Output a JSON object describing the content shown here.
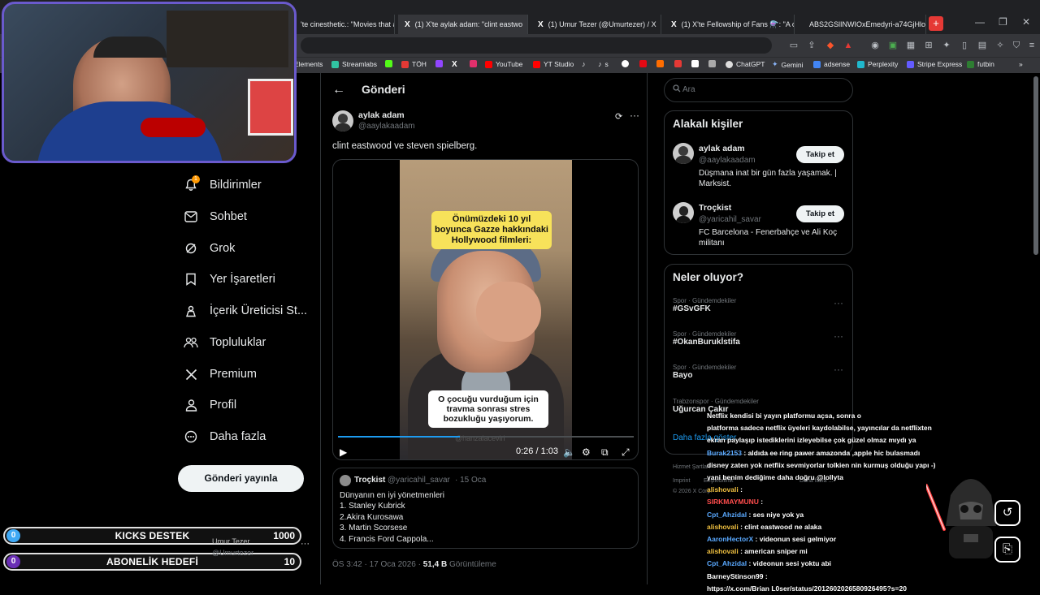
{
  "browser": {
    "tabs": [
      {
        "label": "'te cinesthetic.: \"Movies that are",
        "icon": "x-logo"
      },
      {
        "label": "(1) X'te aylak adam: \"clint eastwo",
        "icon": "x-logo"
      },
      {
        "label": "(1) Umur Tezer (@Umurtezer) / X",
        "icon": "x-logo"
      },
      {
        "label": "(1) X'te Fellowship of Fans ⚗️: \"A ca",
        "icon": "x-logo"
      },
      {
        "label": "ABS2GSlINWIOxEmedyri-a74GjHloS",
        "icon": "red-page-icon"
      }
    ],
    "bookmarks": [
      "Elements",
      "Streamlabs",
      "TÖH",
      "YouTube",
      "YT Studio",
      "s",
      "ChatGPT",
      "Gemini",
      "adsense",
      "Perplexity",
      "Stripe Express",
      "futbin"
    ],
    "accent": "#e53935"
  },
  "nav": {
    "items": [
      {
        "label": "Bildirimler",
        "icon": "bell-icon"
      },
      {
        "label": "Sohbet",
        "icon": "mail-icon"
      },
      {
        "label": "Grok",
        "icon": "grok-icon"
      },
      {
        "label": "Yer İşaretleri",
        "icon": "bookmark-icon"
      },
      {
        "label": "İçerik Üreticisi St...",
        "icon": "creator-icon"
      },
      {
        "label": "Topluluklar",
        "icon": "communities-icon"
      },
      {
        "label": "Premium",
        "icon": "x-logo-icon"
      },
      {
        "label": "Profil",
        "icon": "person-icon"
      },
      {
        "label": "Daha fazla",
        "icon": "more-circle-icon"
      }
    ],
    "notification_count": "1",
    "post_button": "Gönderi yayınla"
  },
  "main": {
    "header": "Gönderi",
    "author": {
      "name": "aylak adam",
      "handle": "@aaylakaadam"
    },
    "text": "clint eastwood ve steven spielberg.",
    "video": {
      "caption_top": "Önümüzdeki 10 yıl boyunca Gazze hakkındaki Hollywood filmleri:",
      "caption_bottom": "O çocuğu vurduğum için travma sonrası stres bozukluğu yaşıyorum.",
      "watermark": "@hanzalacevirl",
      "time": "0:26 / 1:03",
      "progress": 0.413
    },
    "quote": {
      "name": "Troçkist",
      "handle": "@yaricahil_savar",
      "date": "· 15 Oca",
      "lines": [
        "Dünyanın en iyi yönetmenleri",
        "1. Stanley Kubrick",
        "2.Akira Kurosawa",
        "3. Martin Scorsese",
        "4. Francis Ford Cappola..."
      ]
    },
    "footer": {
      "time": "ÖS 3:42 · 17 Oca 2026 · ",
      "views": "51,4 B",
      "views_label": " Görüntüleme"
    }
  },
  "right": {
    "search_placeholder": "Ara",
    "related_title": "Alakalı kişiler",
    "people": [
      {
        "name": "aylak adam",
        "handle": "@aaylakaadam",
        "bio": "Düşmana inat bir gün fazla yaşamak. | Marksist.",
        "button": "Takip et"
      },
      {
        "name": "Troçkist",
        "handle": "@yaricahil_savar",
        "bio": "FC Barcelona - Fenerbahçe ve Ali Koç militanı",
        "button": "Takip et"
      }
    ],
    "trends_title": "Neler oluyor?",
    "trends": [
      {
        "meta": "Spor · Gündemdekiler",
        "name": "#GSvGFK"
      },
      {
        "meta": "Spor · Gündemdekiler",
        "name": "#OkanBurukİstifa"
      },
      {
        "meta": "Spor · Gündemdekiler",
        "name": "Bayo"
      },
      {
        "meta": "Trabzonspor · Gündemdekiler",
        "name": "Uğurcan Çakır"
      }
    ],
    "show_more": "Daha fazla göster",
    "footer_links": [
      "Hizmet Şartları",
      "Imprint",
      "Erişilebilirlik",
      "Daha fazla ...",
      "© 2026 X Corp."
    ]
  },
  "overlay": {
    "goals": [
      {
        "current": "0",
        "label": "KICKS DESTEK",
        "target": "1000",
        "color": "#3fa9f5"
      },
      {
        "current": "0",
        "label": "ABONELİK HEDEFİ",
        "target": "10",
        "color": "#6a2fb5"
      }
    ],
    "streamer_name": "Umur Tezer",
    "streamer_handle": "@Umurtezer",
    "chat": [
      {
        "user": "",
        "msg": "Netflix kendisi bi yayın platformu açsa, sonra o",
        "ucls": "un-w"
      },
      {
        "user": "",
        "msg": "platforma sadece netflix üyeleri kaydolabilse, yayıncılar da netflixten",
        "ucls": "un-w"
      },
      {
        "user": "",
        "msg": "ekran paylaşıp istediklerini izleyebilse çok güzel olmaz mıydı ya",
        "ucls": "un-w"
      },
      {
        "user": "Burak2153",
        "msg": " : aldıda ee ring pawer amazonda ,apple hic bulasmadı",
        "ucls": "un-b"
      },
      {
        "user": "",
        "msg": "disney zaten yok netflix sevmiyorlar tolkien nin kurmuş olduğu yapı -)",
        "ucls": "un-w"
      },
      {
        "user": "",
        "msg": "yani benim dediğime daha doğru @lollyta",
        "ucls": "un-w"
      },
      {
        "user": "alishovali",
        "msg": " : ",
        "ucls": "un-o"
      },
      {
        "user": "SIRKMAYMUNU",
        "msg": " : ",
        "ucls": "un-r"
      },
      {
        "user": "Cpt_Ahzidal",
        "msg": " : ses niye yok ya",
        "ucls": "un-b"
      },
      {
        "user": "alishovali",
        "msg": " : clint eastwood ne alaka",
        "ucls": "un-o"
      },
      {
        "user": "AaronHectorX",
        "msg": " : videonun sesi gelmiyor",
        "ucls": "un-b"
      },
      {
        "user": "alishovali",
        "msg": " : american sniper mi",
        "ucls": "un-o"
      },
      {
        "user": "Cpt_Ahzidal",
        "msg": " : videonun sesi yoktu abi",
        "ucls": "un-b"
      },
      {
        "user": "BarneyStinson99",
        "msg": " :",
        "ucls": "un-w"
      },
      {
        "user": "",
        "msg": "https://x.com/Brian L0ser/status/2012602026580926495?s=20",
        "ucls": "un-w"
      }
    ]
  }
}
